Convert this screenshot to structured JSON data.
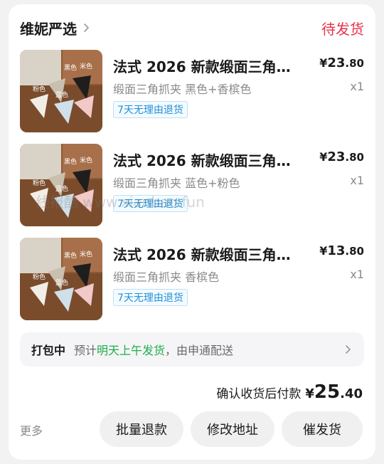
{
  "order": {
    "shop_name": "维妮严选",
    "status": "待发货",
    "items": [
      {
        "title": "法式 2026 新款缎面三角…",
        "price_symbol": "¥",
        "price_int": "23",
        "price_dec": ".80",
        "spec": "缎面三角抓夹 黑色+香槟色",
        "qty": "x1",
        "tag": "7天无理由退货",
        "thumb_labels": [
          "粉色",
          "蓝色",
          "黑色",
          "米色"
        ]
      },
      {
        "title": "法式 2026 新款缎面三角…",
        "price_symbol": "¥",
        "price_int": "23",
        "price_dec": ".80",
        "spec": "缎面三角抓夹 蓝色+粉色",
        "qty": "x1",
        "tag": "7天无理由退货",
        "thumb_labels": [
          "粉色",
          "蓝色",
          "黑色",
          "米色"
        ]
      },
      {
        "title": "法式 2026 新款缎面三角…",
        "price_symbol": "¥",
        "price_int": "13",
        "price_dec": ".80",
        "spec": "缎面三角抓夹 香槟色",
        "qty": "x1",
        "tag": "7天无理由退货",
        "thumb_labels": [
          "粉色",
          "蓝色",
          "黑色",
          "米色"
        ]
      }
    ],
    "shipping": {
      "label": "打包中",
      "text_prefix": "预计",
      "text_highlight": "明天上午发货",
      "text_suffix": "，由申通配送"
    },
    "total": {
      "label": "确认收货后付款",
      "symbol": "¥",
      "int": "25",
      "dec": ".40"
    }
  },
  "actions": {
    "more": "更多",
    "refund": "批量退款",
    "change_address": "修改地址",
    "urge_shipping": "催发货"
  },
  "watermark": "线报酷 www.xianbao.fun",
  "icons": [
    "chevron-right-icon"
  ],
  "colors": {
    "status": "#e8334a",
    "tag": "#1f8fd8",
    "ship_highlight": "#1fae4a"
  }
}
